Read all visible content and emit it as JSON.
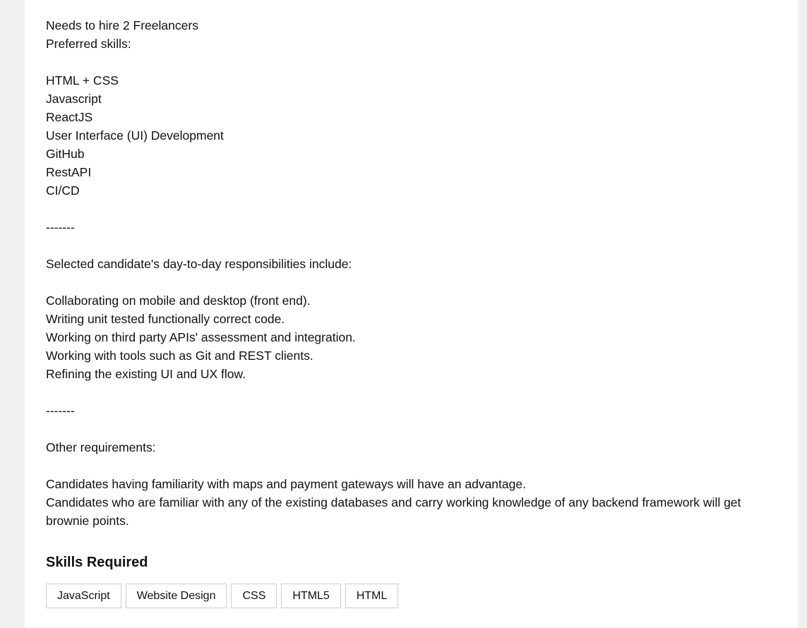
{
  "description": {
    "intro": [
      "Needs to hire 2 Freelancers",
      "Preferred skills:"
    ],
    "preferred_skills": [
      "HTML + CSS",
      "Javascript",
      "ReactJS",
      "User Interface (UI) Development",
      "GitHub",
      "RestAPI",
      "CI/CD"
    ],
    "separator": "-------",
    "responsibilities_heading": "Selected candidate's day-to-day responsibilities include:",
    "responsibilities": [
      "Collaborating on mobile and desktop (front end).",
      "Writing unit tested functionally correct code.",
      "Working on third party APIs' assessment and integration.",
      "Working with tools such as Git and REST clients.",
      "Refining the existing UI and UX flow."
    ],
    "other_heading": "Other requirements:",
    "other_requirements": [
      "Candidates having familiarity with maps and payment gateways will have an advantage.",
      "Candidates who are familiar with any of the existing databases and carry working knowledge of any backend framework will get brownie points."
    ]
  },
  "skills_section": {
    "heading": "Skills Required",
    "tags": [
      "JavaScript",
      "Website Design",
      "CSS",
      "HTML5",
      "HTML"
    ]
  }
}
